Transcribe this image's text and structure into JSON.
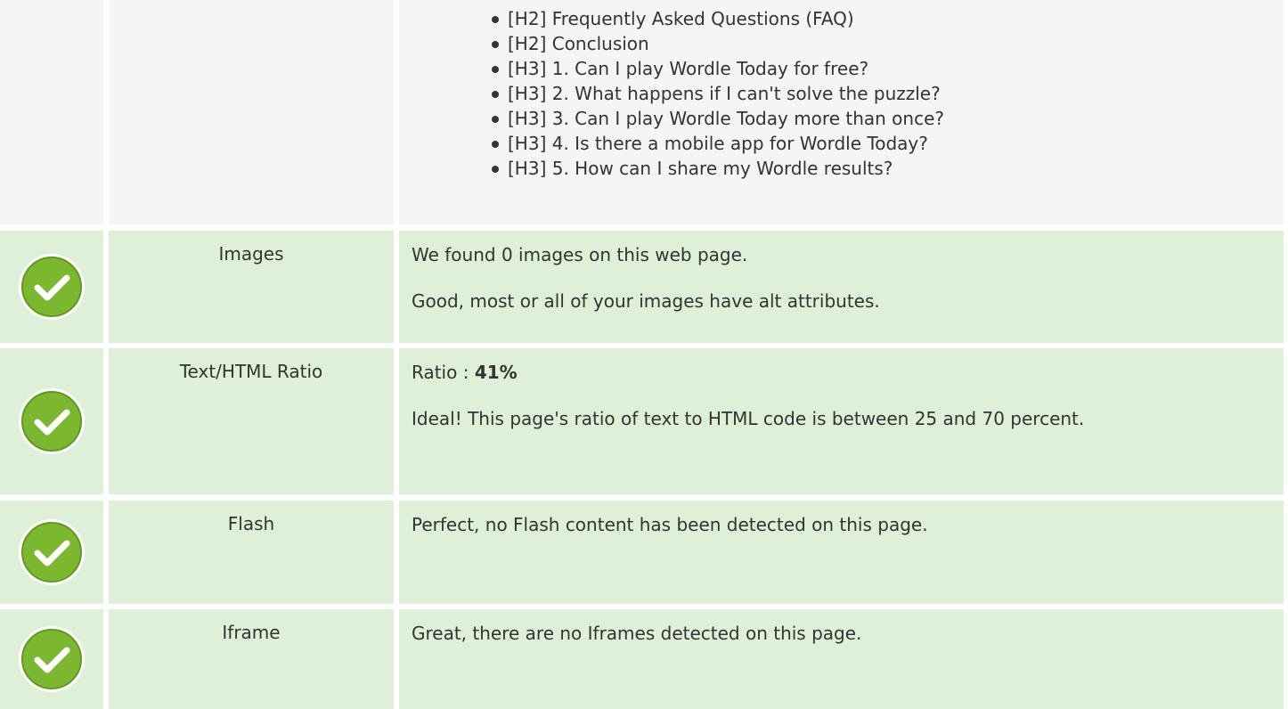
{
  "headings_row": {
    "items": [
      "[H2] Frequently Asked Questions (FAQ)",
      "[H2] Conclusion",
      "[H3] 1. Can I play Wordle Today for free?",
      "[H3] 2. What happens if I can't solve the puzzle?",
      "[H3] 3. Can I play Wordle Today more than once?",
      "[H3] 4. Is there a mobile app for Wordle Today?",
      "[H3] 5. How can I share my Wordle results?"
    ]
  },
  "images": {
    "label": "Images",
    "line1": "We found 0 images on this web page.",
    "line2": "Good, most or all of your images have alt attributes.",
    "status_icon": "check-circle-icon"
  },
  "ratio": {
    "label": "Text/HTML Ratio",
    "prefix": "Ratio : ",
    "value": "41%",
    "line2": "Ideal! This page's ratio of text to HTML code is between 25 and 70 percent.",
    "status_icon": "check-circle-icon"
  },
  "flash": {
    "label": "Flash",
    "line1": "Perfect, no Flash content has been detected on this page.",
    "status_icon": "check-circle-icon"
  },
  "iframe": {
    "label": "Iframe",
    "line1": "Great, there are no Iframes detected on this page.",
    "status_icon": "check-circle-icon"
  },
  "colors": {
    "pass_background": "#dff0d8",
    "neutral_background": "#f5f5f5",
    "check_green": "#7cb82f"
  }
}
